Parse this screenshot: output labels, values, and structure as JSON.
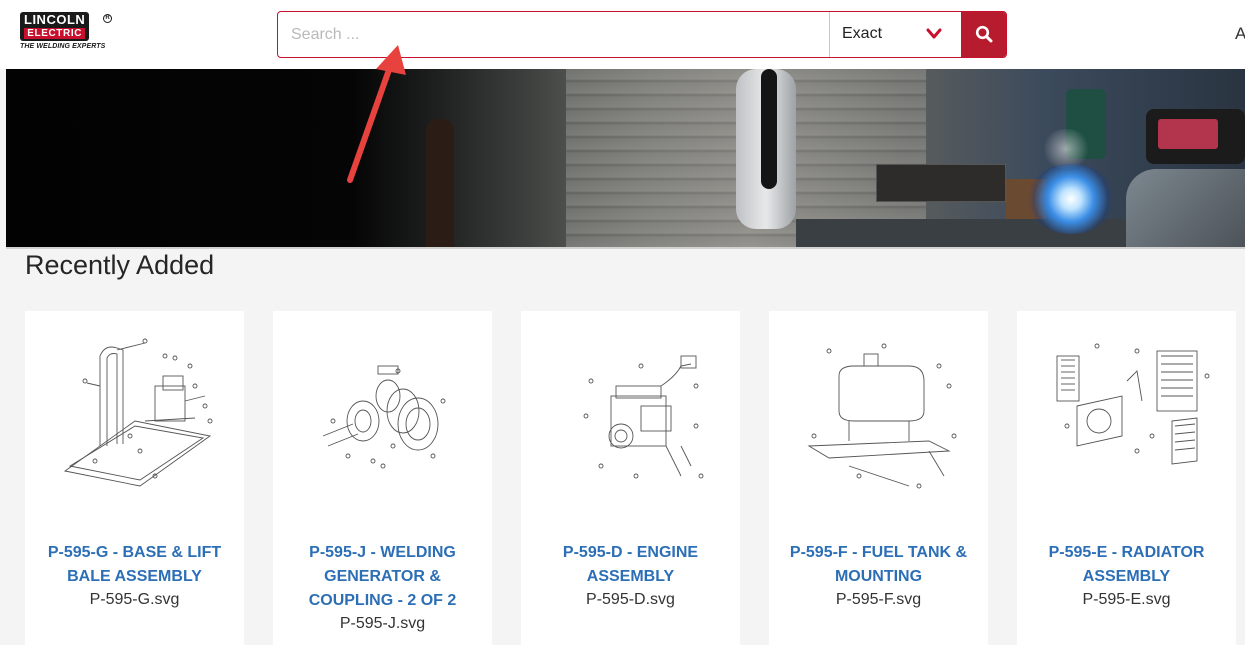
{
  "brand": {
    "line1": "LINCOLN",
    "line2": "ELECTRIC",
    "registered": "R",
    "tagline": "THE WELDING EXPERTS",
    "primary_color": "#c8102e"
  },
  "search": {
    "placeholder": "Search ...",
    "value": "",
    "mode_selected": "Exact",
    "dropdown_icon": "chevron-down-icon",
    "button_icon": "search-icon"
  },
  "header_cut_text": "A",
  "section": {
    "title": "Recently Added"
  },
  "cards": [
    {
      "title": "P-595-G - BASE & LIFT BALE ASSEMBLY",
      "file": "P-595-G.svg"
    },
    {
      "title": "P-595-J - WELDING GENERATOR & COUPLING - 2 OF 2",
      "file": "P-595-J.svg"
    },
    {
      "title": "P-595-D - ENGINE ASSEMBLY",
      "file": "P-595-D.svg"
    },
    {
      "title": "P-595-F - FUEL TANK & MOUNTING",
      "file": "P-595-F.svg"
    },
    {
      "title": "P-595-E - RADIATOR ASSEMBLY",
      "file": "P-595-E.svg"
    }
  ],
  "colors": {
    "link": "#2c6fb6",
    "annotation_arrow": "#e8423f"
  }
}
